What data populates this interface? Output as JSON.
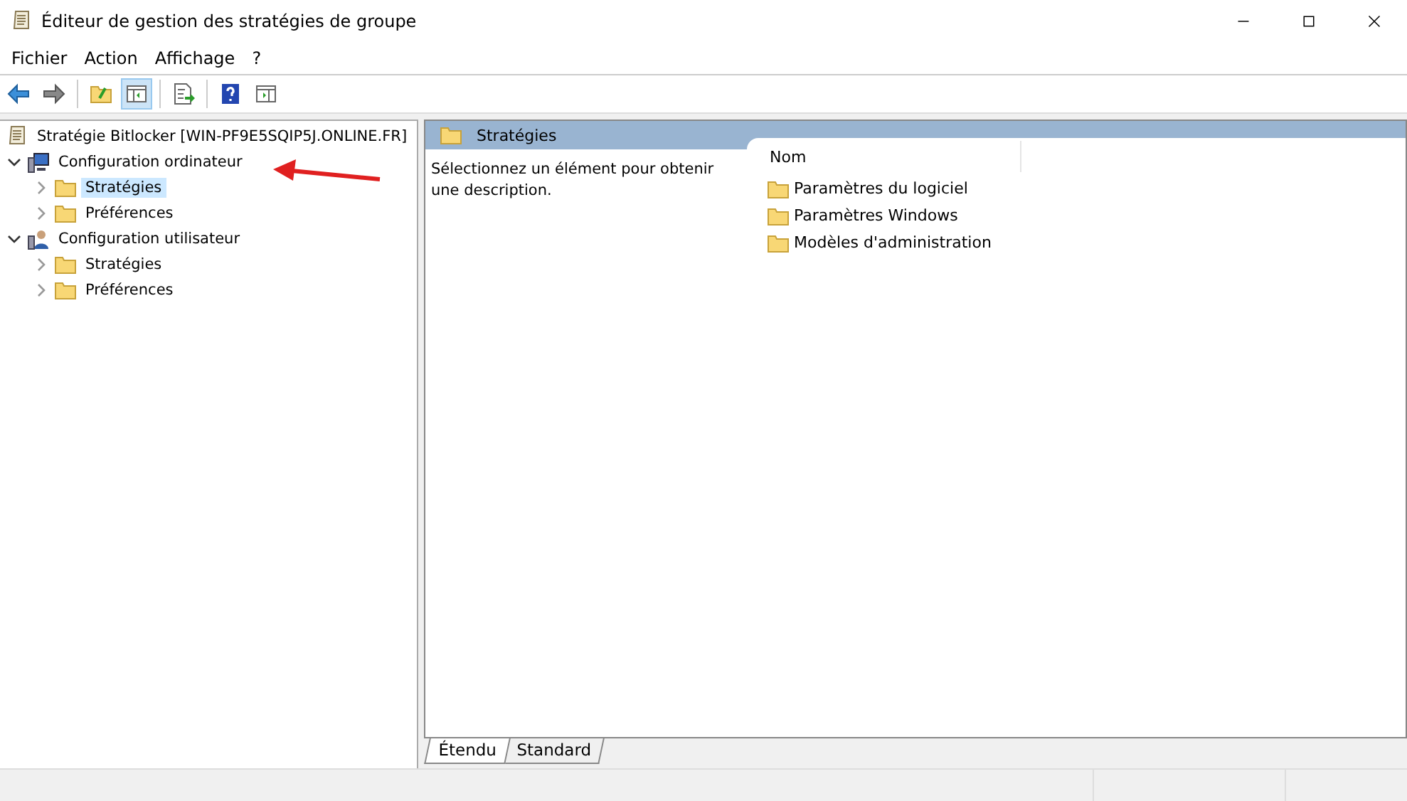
{
  "window": {
    "title": "Éditeur de gestion des stratégies de groupe"
  },
  "menu": [
    "Fichier",
    "Action",
    "Affichage",
    "?"
  ],
  "toolbar": [
    {
      "kind": "back",
      "on": false
    },
    {
      "kind": "forward",
      "on": false
    },
    {
      "kind": "sep"
    },
    {
      "kind": "up",
      "on": false
    },
    {
      "kind": "tree",
      "on": true
    },
    {
      "kind": "sep"
    },
    {
      "kind": "export",
      "on": false
    },
    {
      "kind": "sep"
    },
    {
      "kind": "help",
      "on": false
    },
    {
      "kind": "pane",
      "on": false
    }
  ],
  "tree": {
    "label": "Stratégie Bitlocker [WIN-PF9E5SQIP5J.ONLINE.FR]",
    "children": [
      {
        "label": "Configuration ordinateur",
        "kind": "computer",
        "expanded": true,
        "children": [
          {
            "label": "Stratégies",
            "kind": "folder",
            "expanded": false,
            "selected": true
          },
          {
            "label": "Préférences",
            "kind": "folder",
            "expanded": false,
            "selected": false
          }
        ]
      },
      {
        "label": "Configuration utilisateur",
        "kind": "user",
        "expanded": true,
        "children": [
          {
            "label": "Stratégies",
            "kind": "folder",
            "expanded": false,
            "selected": false
          },
          {
            "label": "Préférences",
            "kind": "folder",
            "expanded": false,
            "selected": false
          }
        ]
      }
    ]
  },
  "content": {
    "header": "Stratégies",
    "description": "Sélectionnez un élément pour obtenir une description.",
    "columns": [
      "Nom"
    ],
    "items": [
      "Paramètres du logiciel",
      "Paramètres Windows",
      "Modèles d'administration"
    ]
  },
  "tabs": [
    {
      "label": "Étendu",
      "selected": true
    },
    {
      "label": "Standard",
      "selected": false
    }
  ]
}
